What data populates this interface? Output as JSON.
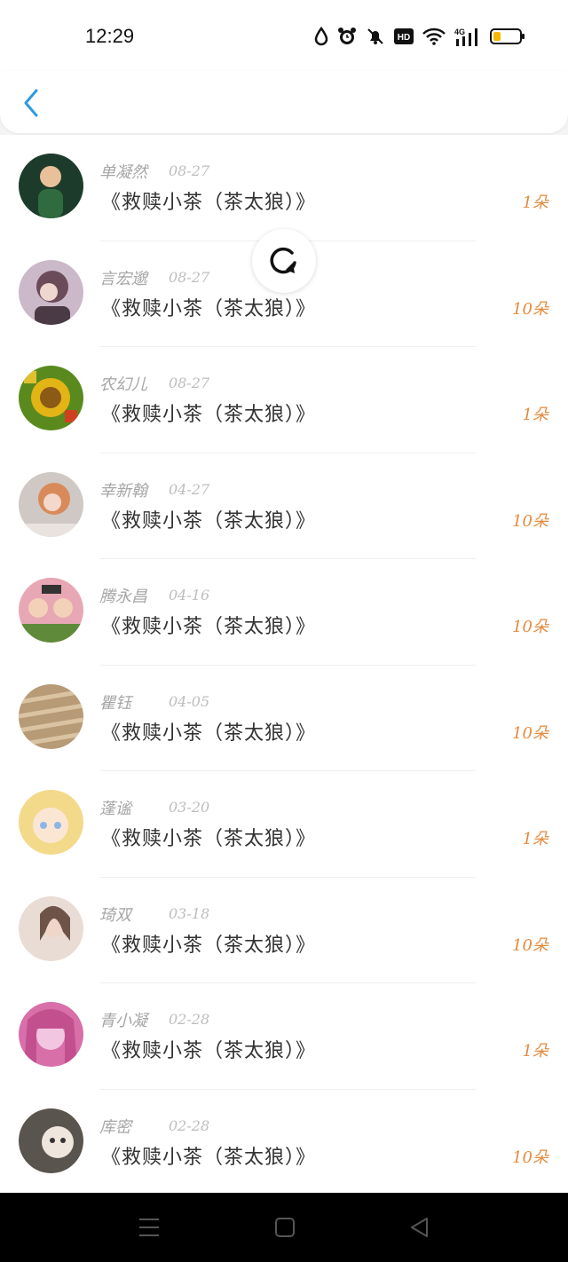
{
  "status_bar": {
    "time": "12:29"
  },
  "header": {
    "back_icon": "chevron-left-icon"
  },
  "refresh": {
    "icon": "refresh-icon"
  },
  "items": [
    {
      "name": "单凝然",
      "date": "08-27",
      "title": "《救赎小茶（茶太狼）》",
      "amount": "1朵",
      "avatar": {
        "bg": "#1c3b2a",
        "fg": "#e8c19b"
      }
    },
    {
      "name": "言宏邈",
      "date": "08-27",
      "title": "《救赎小茶（茶太狼）》",
      "amount": "10朵",
      "avatar": {
        "bg": "#cbb8c8",
        "fg": "#6b4b5a"
      }
    },
    {
      "name": "农幻儿",
      "date": "08-27",
      "title": "《救赎小茶（茶太狼）》",
      "amount": "1朵",
      "avatar": {
        "bg": "#5a8a1e",
        "fg": "#e3b416"
      }
    },
    {
      "name": "幸新翰",
      "date": "04-27",
      "title": "《救赎小茶（茶太狼）》",
      "amount": "10朵",
      "avatar": {
        "bg": "#cfc8c4",
        "fg": "#d98a5a"
      }
    },
    {
      "name": "腾永昌",
      "date": "04-16",
      "title": "《救赎小茶（茶太狼）》",
      "amount": "10朵",
      "avatar": {
        "bg": "#e8a7b4",
        "fg": "#5f8a3a"
      }
    },
    {
      "name": "瞿钰",
      "date": "04-05",
      "title": "《救赎小茶（茶太狼）》",
      "amount": "10朵",
      "avatar": {
        "bg": "#b79a76",
        "fg": "#d9c3a2"
      }
    },
    {
      "name": "蓬谧",
      "date": "03-20",
      "title": "《救赎小茶（茶太狼）》",
      "amount": "1朵",
      "avatar": {
        "bg": "#f3d98a",
        "fg": "#8fb5e6"
      }
    },
    {
      "name": "琦双",
      "date": "03-18",
      "title": "《救赎小茶（茶太狼）》",
      "amount": "10朵",
      "avatar": {
        "bg": "#e9dcd4",
        "fg": "#6e5448"
      }
    },
    {
      "name": "青小凝",
      "date": "02-28",
      "title": "《救赎小茶（茶太狼）》",
      "amount": "1朵",
      "avatar": {
        "bg": "#d86fa8",
        "fg": "#f2c6e0"
      }
    },
    {
      "name": "库密",
      "date": "02-28",
      "title": "《救赎小茶（茶太狼）》",
      "amount": "10朵",
      "avatar": {
        "bg": "#5a544e",
        "fg": "#efe6dd"
      }
    }
  ],
  "nav": {
    "menu_icon": "menu-icon",
    "home_icon": "home-square-icon",
    "back_icon": "back-triangle-icon"
  }
}
